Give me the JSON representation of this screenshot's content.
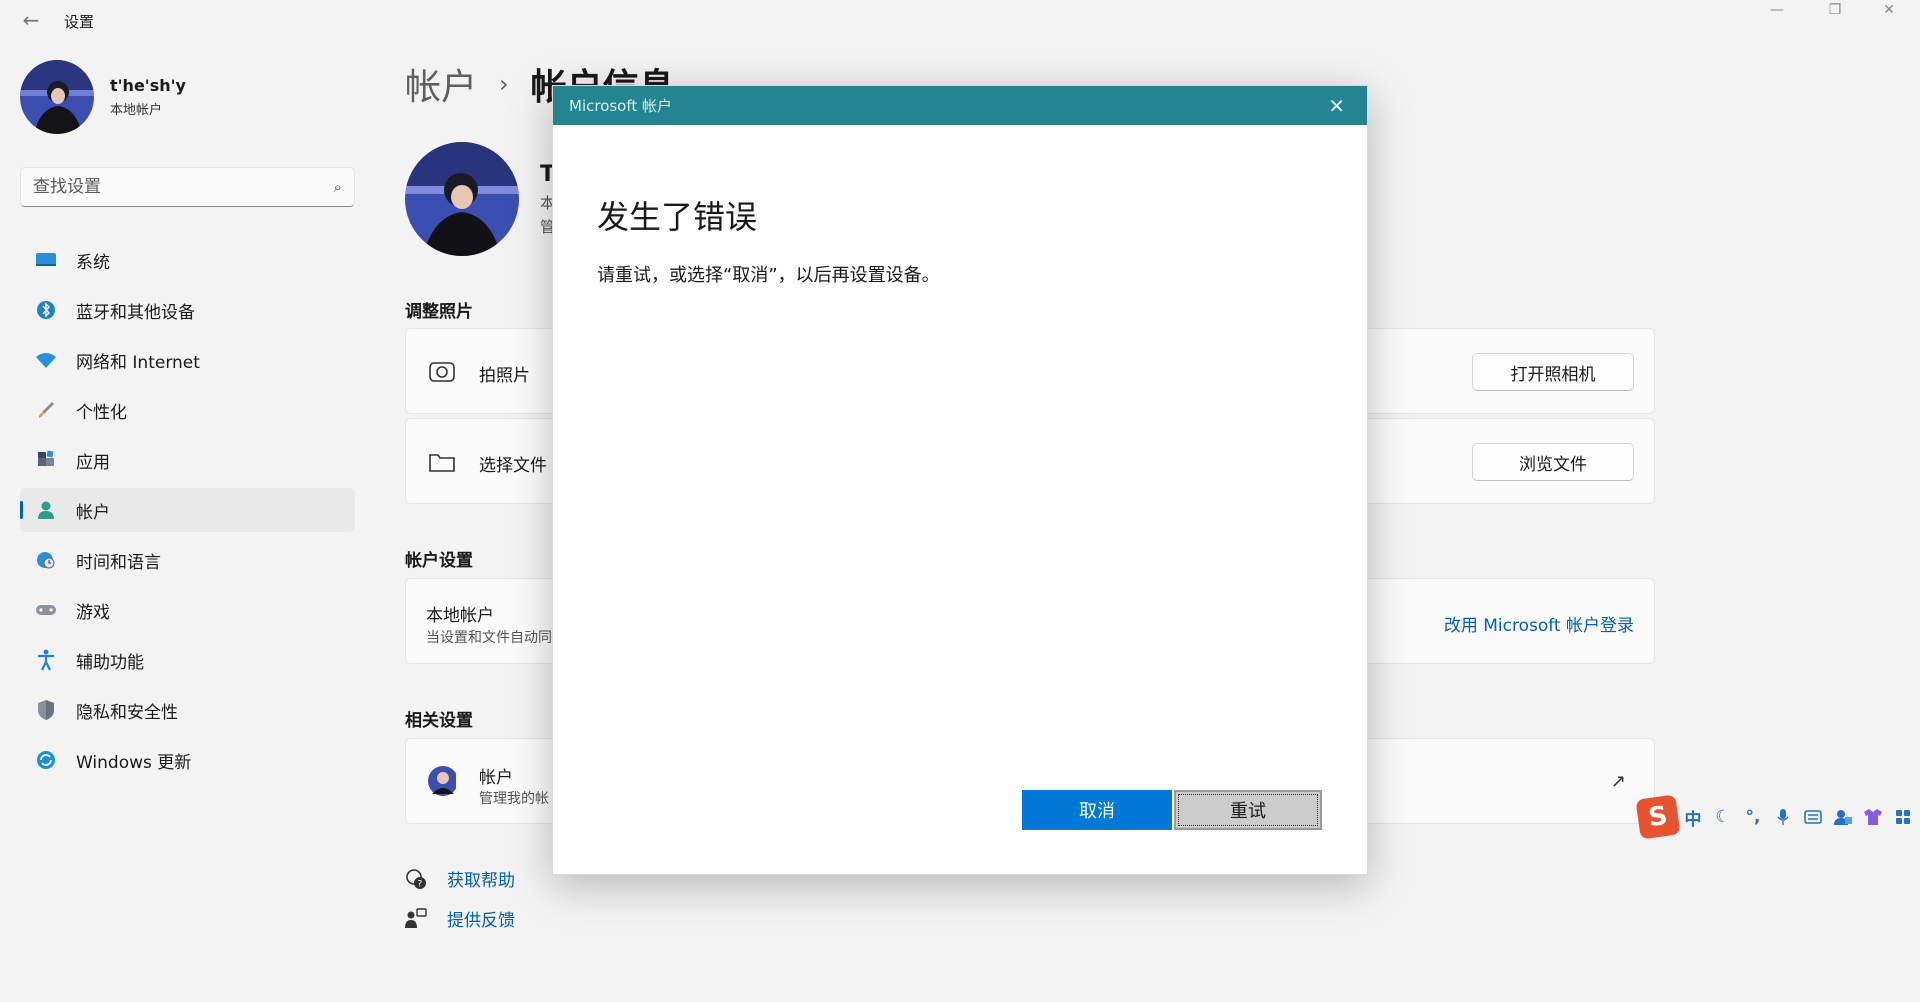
{
  "window": {
    "title": "设置"
  },
  "profile": {
    "name": "t'he'sh'y",
    "account_type": "本地帐户"
  },
  "search": {
    "placeholder": "查找设置"
  },
  "nav": {
    "items": [
      {
        "label": "系统",
        "icon": "monitor-icon"
      },
      {
        "label": "蓝牙和其他设备",
        "icon": "bluetooth-icon"
      },
      {
        "label": "网络和 Internet",
        "icon": "wifi-icon"
      },
      {
        "label": "个性化",
        "icon": "brush-icon"
      },
      {
        "label": "应用",
        "icon": "apps-icon"
      },
      {
        "label": "帐户",
        "icon": "person-icon",
        "active": true
      },
      {
        "label": "时间和语言",
        "icon": "globe-clock-icon"
      },
      {
        "label": "游戏",
        "icon": "gamepad-icon"
      },
      {
        "label": "辅助功能",
        "icon": "accessibility-icon"
      },
      {
        "label": "隐私和安全性",
        "icon": "shield-icon"
      },
      {
        "label": "Windows 更新",
        "icon": "update-icon"
      }
    ]
  },
  "breadcrumb": {
    "parent": "帐户",
    "separator": "›",
    "current": "帐户信息"
  },
  "user": {
    "title": "T",
    "line2": "本",
    "line3": "管"
  },
  "sections": {
    "photo_title": "调整照片",
    "account_settings_title": "帐户设置",
    "related_title": "相关设置"
  },
  "cards": {
    "take_photo": {
      "label": "拍照片",
      "button": "打开照相机"
    },
    "choose_file": {
      "label": "选择文件",
      "button": "浏览文件"
    },
    "local_account": {
      "label": "本地帐户",
      "sub": "当设置和文件自动同",
      "link": "改用 Microsoft 帐户登录"
    },
    "accounts": {
      "label": "帐户",
      "sub": "管理我的帐"
    }
  },
  "help": {
    "get_help": "获取帮助",
    "feedback": "提供反馈"
  },
  "dialog": {
    "title": "Microsoft 帐户",
    "heading": "发生了错误",
    "body": "请重试，或选择“取消”，以后再设置设备。",
    "cancel": "取消",
    "retry": "重试"
  },
  "ime": {
    "logo": "S",
    "mode": "中",
    "punct": "°,"
  },
  "colors": {
    "accent": "#005fb8",
    "dialog_header": "#248491",
    "primary_button": "#0078d7",
    "ime_logo": "#e8532f"
  }
}
